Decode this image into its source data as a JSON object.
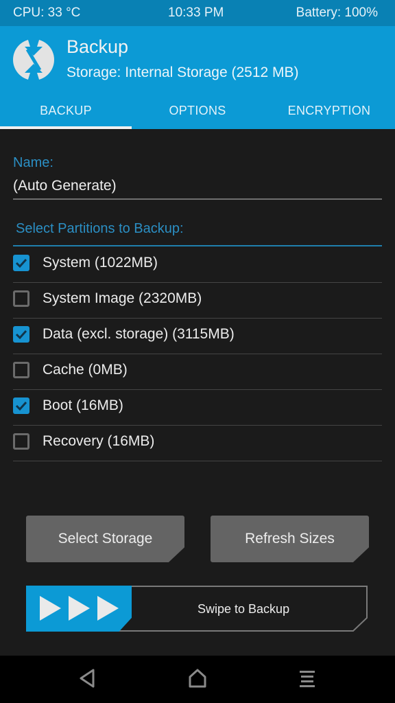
{
  "status_bar": {
    "cpu": "CPU: 33 °C",
    "time": "10:33 PM",
    "battery": "Battery: 100%"
  },
  "header": {
    "logo_icon": "twrp-logo-icon",
    "title": "Backup",
    "subtitle": "Storage: Internal Storage (2512 MB)"
  },
  "tabs": [
    {
      "label": "BACKUP",
      "active": true
    },
    {
      "label": "OPTIONS",
      "active": false
    },
    {
      "label": "ENCRYPTION",
      "active": false
    }
  ],
  "name_field": {
    "label": "Name:",
    "value": "(Auto Generate)"
  },
  "partitions": {
    "label": "Select Partitions to Backup:",
    "items": [
      {
        "label": "System (1022MB)",
        "checked": true
      },
      {
        "label": "System Image (2320MB)",
        "checked": false
      },
      {
        "label": "Data (excl. storage) (3115MB)",
        "checked": true
      },
      {
        "label": "Cache (0MB)",
        "checked": false
      },
      {
        "label": "Boot (16MB)",
        "checked": true
      },
      {
        "label": "Recovery (16MB)",
        "checked": false
      }
    ]
  },
  "buttons": {
    "select_storage": "Select Storage",
    "refresh_sizes": "Refresh Sizes"
  },
  "swipe": {
    "label": "Swipe to Backup",
    "icon": "triple-arrow-icon"
  },
  "nav_bar": {
    "back": "back-icon",
    "home": "home-icon",
    "menu": "menu-icon"
  },
  "colors": {
    "accent": "#0c9ad5",
    "status_bar": "#0981b4",
    "background": "#1b1b1b",
    "button": "#646464"
  }
}
